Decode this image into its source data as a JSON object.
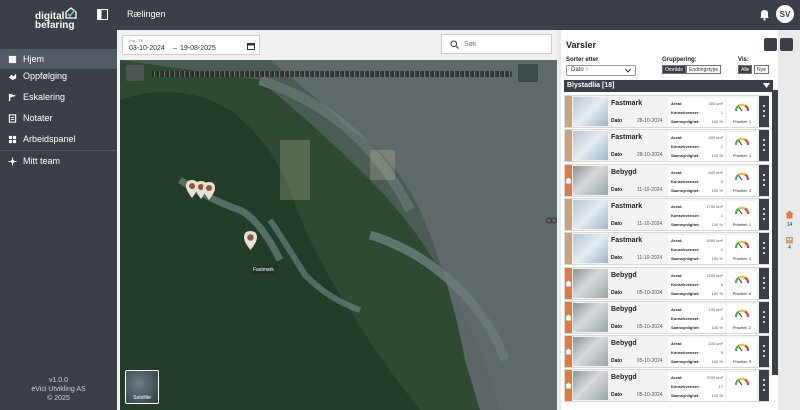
{
  "brand": {
    "line1": "digital",
    "line2": "befaring"
  },
  "nav": [
    {
      "label": "Hjem",
      "icon": "home-icon",
      "active": true
    },
    {
      "label": "Oppfølging",
      "icon": "handshake-icon"
    },
    {
      "label": "Eskalering",
      "icon": "flag-icon"
    },
    {
      "label": "Notater",
      "icon": "note-icon"
    },
    {
      "label": "Arbeidspanel",
      "icon": "grid-icon"
    },
    {
      "label": "Mitt team",
      "icon": "team-icon"
    }
  ],
  "footer": {
    "version": "v1.0.0",
    "company": "eVici Utvikling AS",
    "copyright": "© 2025"
  },
  "header": {
    "title": "Rælingen",
    "avatar": "SV"
  },
  "date_range": {
    "label": "Fra - Til",
    "from": "03-10-2024",
    "separator": "–",
    "to": "19-08-2025"
  },
  "search": {
    "placeholder": "Søk"
  },
  "map": {
    "pin_label": "Fastmark",
    "layer_toggle": "Satellite"
  },
  "panel": {
    "title": "Varsler",
    "sort_label": "Sorter etter",
    "sort_value": "Dato ↑",
    "group_label": "Gruppering:",
    "group_options": [
      "Område",
      "Endringstype"
    ],
    "show_label": "Vis:",
    "show_options": [
      "Alle",
      "Nye"
    ],
    "group_header": "Blystadlia [18]",
    "labels": {
      "area": "Areal:",
      "conseq": "Konsekvenser:",
      "prob": "Sannsynlighet:",
      "date": "Dato"
    },
    "cards": [
      {
        "type": "Fastmark",
        "date": "28-10-2024",
        "area": "300 km²",
        "conseq": "1",
        "prob": "100 %",
        "priority": "Prioritet: 1",
        "strip": "#c9a47a",
        "icon": "none"
      },
      {
        "type": "Fastmark",
        "date": "28-10-2024",
        "area": "400 km²",
        "conseq": "1",
        "prob": "100 %",
        "priority": "Prioritet: 1",
        "strip": "#c9a47a",
        "icon": "none"
      },
      {
        "type": "Bebygd",
        "date": "11-10-2024",
        "area": "600 km²",
        "conseq": "3",
        "prob": "100 %",
        "priority": "Prioritet: 3",
        "strip": "#e07a3e",
        "icon": "house"
      },
      {
        "type": "Fastmark",
        "date": "11-10-2024",
        "area": "1700 km²",
        "conseq": "1",
        "prob": "100 %",
        "priority": "Prioritet: 1",
        "strip": "#c9a47a",
        "icon": "none"
      },
      {
        "type": "Fastmark",
        "date": "11-10-2024",
        "area": "1000 km²",
        "conseq": "1",
        "prob": "100 %",
        "priority": "Prioritet: 1",
        "strip": "#c9a47a",
        "icon": "none"
      },
      {
        "type": "Bebygd",
        "date": "05-10-2024",
        "area": "1200 km²",
        "conseq": "8",
        "prob": "100 %",
        "priority": "Prioritet: 8",
        "strip": "#e07a3e",
        "icon": "house"
      },
      {
        "type": "Bebygd",
        "date": "05-10-2024",
        "area": "100 km²",
        "conseq": "2",
        "prob": "100 %",
        "priority": "Prioritet: 2",
        "strip": "#e07a3e",
        "icon": "house"
      },
      {
        "type": "Bebygd",
        "date": "05-10-2024",
        "area": "100 km²",
        "conseq": "5",
        "prob": "100 %",
        "priority": "Prioritet: 5",
        "strip": "#e07a3e",
        "icon": "house"
      },
      {
        "type": "Bebygd",
        "date": "05-10-2024",
        "area": "3700 km²",
        "conseq": "17",
        "prob": "100 %",
        "priority": "",
        "strip": "#e07a3e",
        "icon": "house"
      }
    ]
  },
  "side_counts": {
    "houses": "14",
    "buildings": "4"
  },
  "colors": {
    "sidebar": "#3b3f47",
    "accent_orange": "#e07a3e",
    "fastmark_tan": "#c9a47a"
  }
}
